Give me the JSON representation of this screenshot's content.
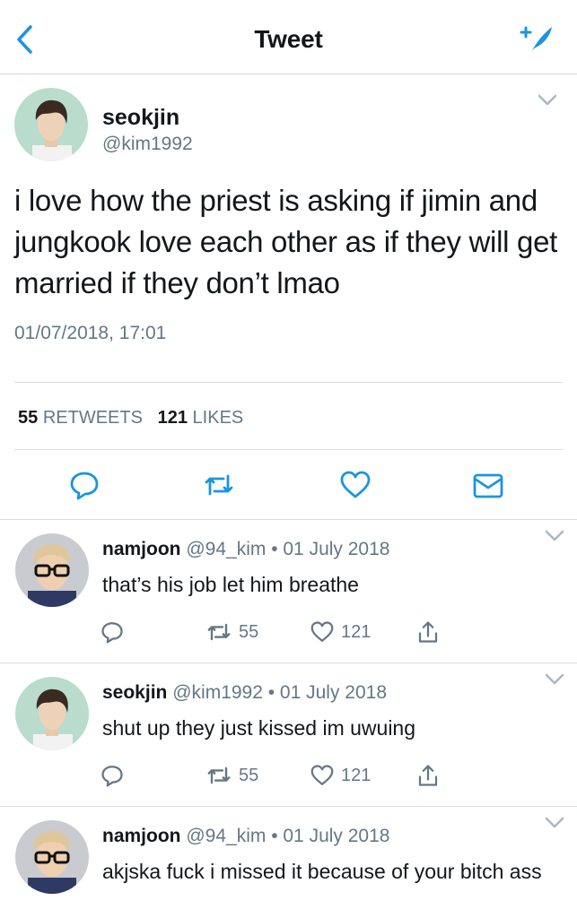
{
  "header": {
    "title": "Tweet"
  },
  "tweet": {
    "author_name": "seokjin",
    "author_handle": "@kim1992",
    "text": "i love how the priest is asking if jimin and jungkook love each other as if they will get married if they don’t lmao",
    "timestamp": "01/07/2018, 17:01",
    "retweet_count": "55",
    "retweet_label": "RETWEETS",
    "like_count": "121",
    "like_label": "LIKES"
  },
  "replies": [
    {
      "name": "namjoon",
      "meta": "@94_kim • 01 July 2018",
      "text": "that’s his job let him breathe",
      "retweets": "55",
      "likes": "121"
    },
    {
      "name": "seokjin",
      "meta": "@kim1992 • 01 July 2018",
      "text": "shut up they just kissed im uwuing",
      "retweets": "55",
      "likes": "121"
    },
    {
      "name": "namjoon",
      "meta": "@94_kim • 01 July 2018",
      "text": "akjska fuck i missed it because of your bitch ass"
    }
  ],
  "colors": {
    "accent": "#1da1f2",
    "icon": "#1c94e0",
    "secondary_text": "#657786"
  },
  "icons": [
    "back-chevron-icon",
    "compose-feather-icon",
    "reply-icon",
    "retweet-icon",
    "like-icon",
    "message-icon",
    "share-icon",
    "chevron-down-icon"
  ]
}
